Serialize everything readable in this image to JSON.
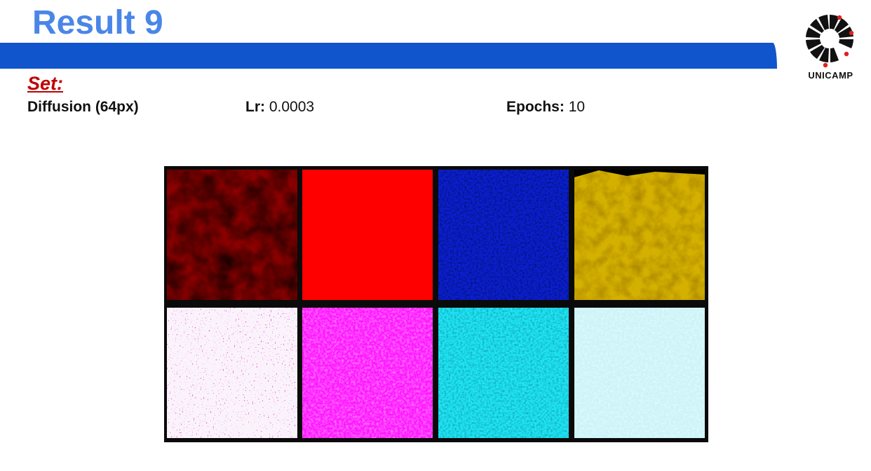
{
  "slide": {
    "title": "Result 9",
    "logo_text": "UNICAMP",
    "set_label": "Set:",
    "params": {
      "model_value": "Diffusion (64px)",
      "lr_label": "Lr:",
      "lr_value": "0.0003",
      "epochs_label": "Epochs:",
      "epochs_value": "10"
    }
  },
  "colors": {
    "title": "#4a86e8",
    "bar": "#1155cc",
    "set_label": "#c00000"
  },
  "samples": [
    {
      "name": "dark-red-noise",
      "color": "#8b0000"
    },
    {
      "name": "solid-red",
      "color": "#ff0000"
    },
    {
      "name": "blue-noise",
      "color": "#0a1fd0"
    },
    {
      "name": "yellow-brown-noise",
      "color": "#d4b000"
    },
    {
      "name": "white-magenta-speckle",
      "color": "#fbf3fb"
    },
    {
      "name": "magenta-noise",
      "color": "#ff1aff"
    },
    {
      "name": "cyan-noise",
      "color": "#1ee4f5"
    },
    {
      "name": "light-cyan-noise",
      "color": "#ccf4f8"
    }
  ]
}
